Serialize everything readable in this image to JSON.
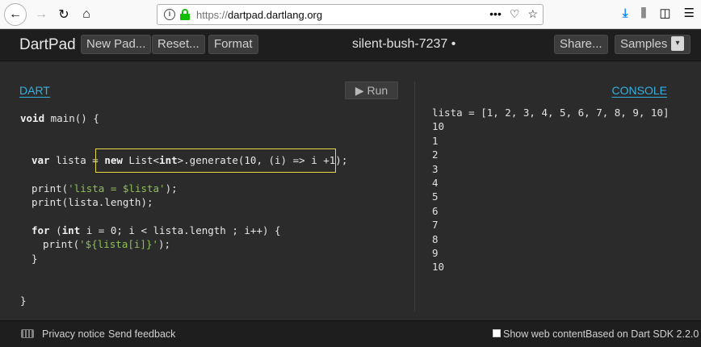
{
  "browser": {
    "url_prefix": "https://",
    "url_host": "dartpad.dartlang.org",
    "page_actions": "•••",
    "icons": [
      "back-icon",
      "forward-icon",
      "reload-icon",
      "home-icon",
      "info-icon",
      "lock-icon",
      "pocket-icon",
      "bookmark-star-icon",
      "download-icon",
      "library-icon",
      "sidebar-icon",
      "menu-icon"
    ]
  },
  "header": {
    "title": "DartPad",
    "new_pad": "New Pad...",
    "reset": "Reset...",
    "format": "Format",
    "pad_name": "silent-bush-7237 •",
    "share": "Share...",
    "samples": "Samples",
    "samples_arrow": "▾"
  },
  "editor": {
    "label": "DART",
    "run": "▶ Run",
    "lines": [
      {
        "pre": "",
        "kw": "void",
        "rest": " main() {"
      },
      {
        "pre": "  ",
        "kw": "var",
        "rest": " lista = "
      },
      {
        "pre": "  ",
        "kw": "",
        "rest": ""
      },
      {
        "pre": "",
        "kw": "",
        "rest": ""
      }
    ],
    "line_main": "void main() {",
    "line_var_kw": "var",
    "line_var_a": " lista = ",
    "line_var_new": "new",
    "line_var_b": " List<",
    "line_var_int": "int",
    "line_var_c": ">.generate(10, (i) => i +1);",
    "line_print1_a": "print(",
    "line_print1_str": "'lista = $lista'",
    "line_print1_b": ");",
    "line_print2": "print(lista.length);",
    "line_for_kw": "for",
    "line_for_a": " (",
    "line_for_int": "int",
    "line_for_b": " i = 0; i < lista.length ; i++) {",
    "line_print3_a": "print(",
    "line_print3_str": "'${lista[i]}'",
    "line_print3_b": ");",
    "line_close_inner": "}",
    "line_close_main": "}"
  },
  "console": {
    "label": "CONSOLE",
    "lines": [
      "lista = [1, 2, 3, 4, 5, 6, 7, 8, 9, 10]",
      "10",
      "1",
      "2",
      "3",
      "4",
      "5",
      "6",
      "7",
      "8",
      "9",
      "10"
    ]
  },
  "footer": {
    "privacy": "Privacy notice",
    "feedback": "Send feedback",
    "show_web": "Show web content",
    "sdk": "Based on Dart SDK 2.2.0"
  },
  "colors": {
    "accent": "#34b0e3",
    "highlight_box": "#e5d94a",
    "background": "#2b2b2b"
  }
}
